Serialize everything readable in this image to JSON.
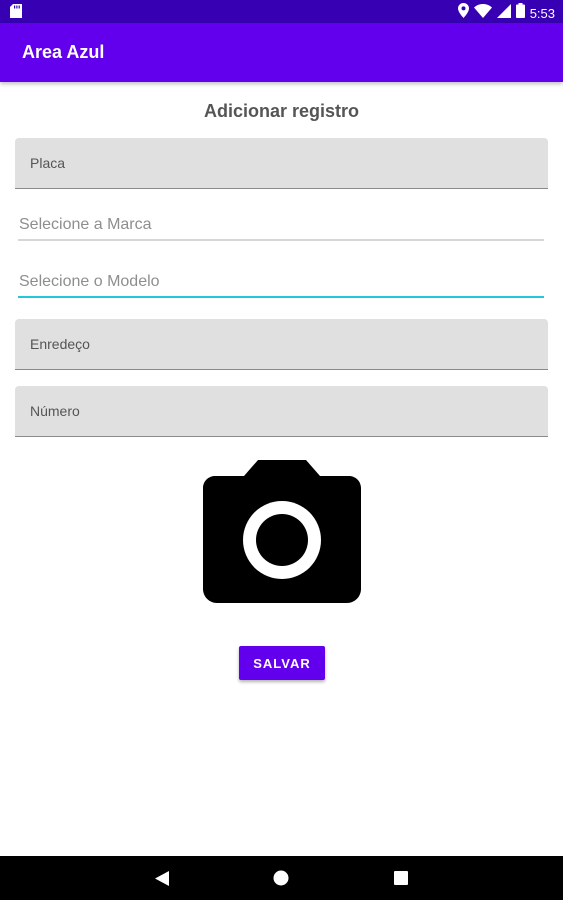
{
  "status_bar": {
    "time": "5:53",
    "icons": [
      "sd-card-icon",
      "location-icon",
      "wifi-icon",
      "signal-icon",
      "battery-icon"
    ]
  },
  "app_bar": {
    "title": "Area Azul"
  },
  "form": {
    "title": "Adicionar registro",
    "placa": {
      "placeholder": "Placa",
      "value": ""
    },
    "marca": {
      "hint": "Selecione a Marca"
    },
    "modelo": {
      "hint": "Selecione o Modelo",
      "focused": true
    },
    "endereco": {
      "placeholder": "Enredeço",
      "value": ""
    },
    "numero": {
      "placeholder": "Número",
      "value": ""
    },
    "camera_icon": "camera-icon",
    "save_label": "SALVAR"
  },
  "nav_bar": {
    "icons": [
      "back-icon",
      "home-icon",
      "recents-icon"
    ]
  },
  "colors": {
    "primary": "#6200ee",
    "primary_dark": "#3700b3",
    "accent": "#26c6da",
    "field_bg": "#e0e0e0"
  }
}
